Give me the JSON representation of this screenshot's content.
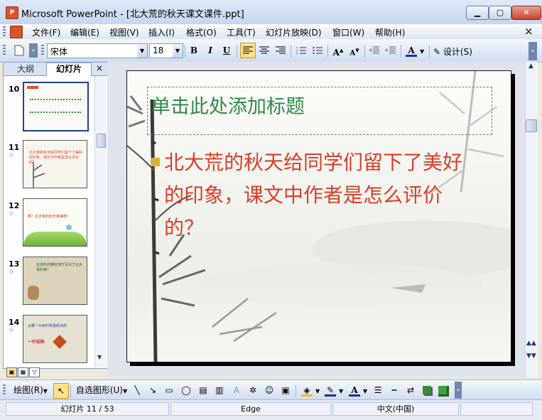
{
  "window": {
    "icon_label": "P",
    "title": "Microsoft PowerPoint - [北大荒的秋天课文课件.ppt]",
    "controls": {
      "minimize": "▁",
      "maximize": "▢",
      "close": "✕"
    }
  },
  "menu": {
    "items": [
      "文件(F)",
      "编辑(E)",
      "视图(V)",
      "插入(I)",
      "格式(O)",
      "工具(T)",
      "幻灯片放映(D)",
      "窗口(W)",
      "帮助(H)"
    ],
    "doc_close": "×"
  },
  "format_toolbar": {
    "font_name": "宋体",
    "font_size": "18",
    "bold": "B",
    "italic": "I",
    "underline": "U",
    "design_label": "设计(S)"
  },
  "pane": {
    "tabs": [
      "大纲",
      "幻灯片"
    ],
    "close": "×",
    "thumbnails": [
      {
        "num": "10",
        "caption": "",
        "bg": "#fbfbf6"
      },
      {
        "num": "11",
        "caption": "北大荒的秋天给同学们留下了美好的印象，课文中作者是怎么评价的？",
        "bg": "#f7f5ee"
      },
      {
        "num": "12",
        "caption": "啊！北大荒的秋天真美呀！",
        "bg": "#fbfbf4"
      },
      {
        "num": "13",
        "caption": "在课文的哪些地方写出了北大荒的美？",
        "bg": "#ded4bd"
      },
      {
        "num": "14",
        "caption": "从哪一片树叶知道秋天的",
        "bg": "#e7e1d1"
      }
    ],
    "star": "☆",
    "thumb14_extra": "一叶知秋"
  },
  "slide": {
    "title_placeholder": "单击此处添加标题",
    "body_text": "北大荒的秋天给同学们留下了美好的印象，课文中作者是怎么评价的？"
  },
  "draw_toolbar": {
    "draw_menu": "绘图(R)",
    "autoshapes": "自选图形(U)"
  },
  "status": {
    "slide_indicator": "幻灯片 11 / 53",
    "template": "Edge",
    "language": "中文(中国)"
  },
  "colors": {
    "title_green": "#2f8a4b",
    "body_red": "#d9402a",
    "bullet_gold": "#d6b43a",
    "chrome_blue": "#c5d6ee"
  }
}
